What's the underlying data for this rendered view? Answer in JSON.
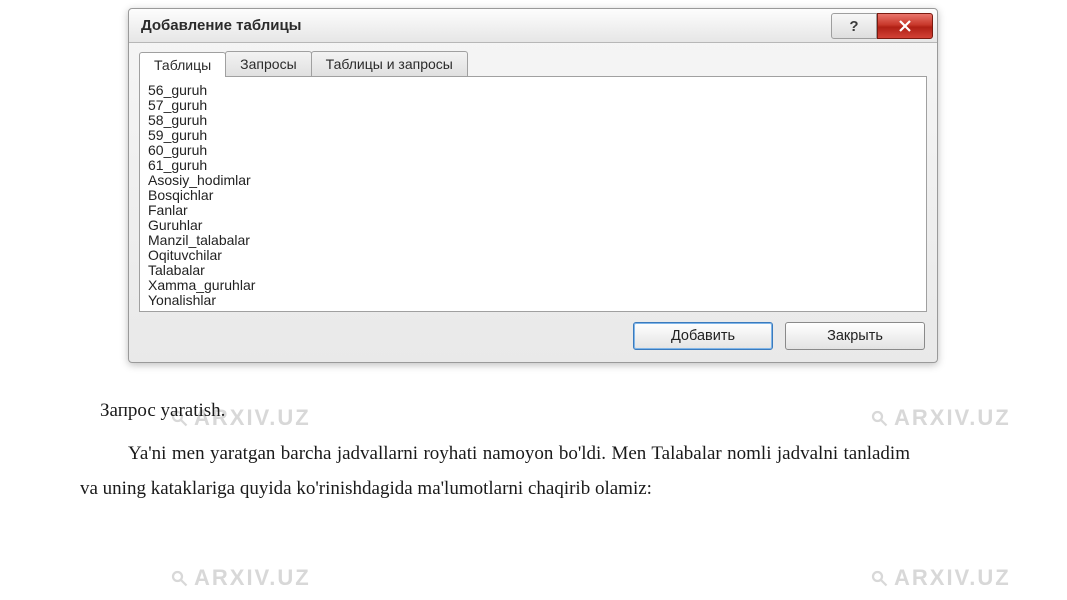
{
  "dialog": {
    "title": "Добавление таблицы",
    "help_label": "?",
    "tabs": {
      "tables": "Таблицы",
      "queries": "Запросы",
      "both": "Таблицы и запросы"
    },
    "list_items": [
      "56_guruh",
      "57_guruh",
      "58_guruh",
      "59_guruh",
      "60_guruh",
      "61_guruh",
      "Asosiy_hodimlar",
      "Bosqichlar",
      "Fanlar",
      "Guruhlar",
      "Manzil_talabalar",
      "Oqituvchilar",
      "Talabalar",
      "Xamma_guruhlar",
      "Yonalishlar"
    ],
    "buttons": {
      "add": "Добавить",
      "close": "Закрыть"
    }
  },
  "doc": {
    "line1": "Запрос yaratish.",
    "paragraph": "Ya'ni men yaratgan barcha jadvallarni royhati namoyon bo'ldi. Men Talabalar nomli jadvalni tanladim va uning kataklariga quyida ko'rinishdagida ma'lumotlarni chaqirib olamiz:"
  },
  "watermark_text": "ARXIV.UZ"
}
